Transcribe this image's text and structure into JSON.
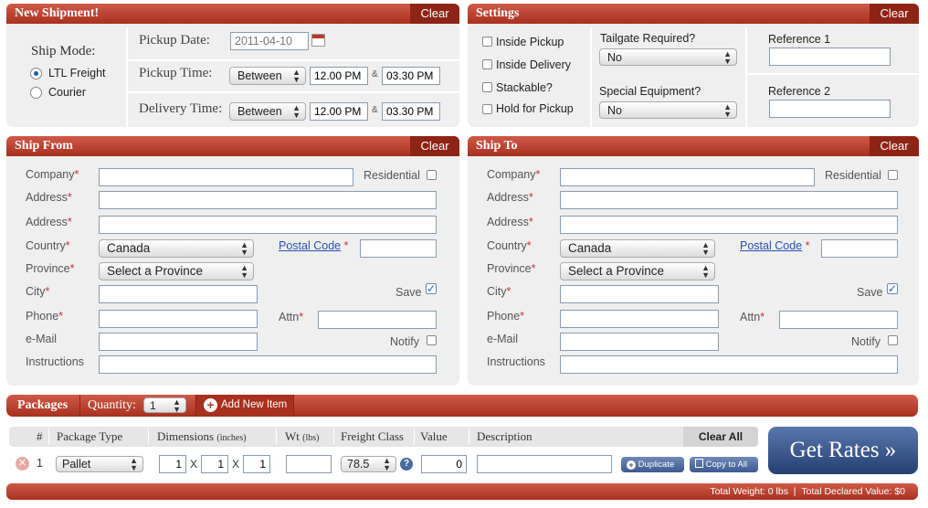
{
  "new_shipment": {
    "title": "New Shipment!",
    "clear": "Clear",
    "ship_mode_label": "Ship Mode:",
    "mode_ltl": "LTL Freight",
    "mode_courier": "Courier",
    "pickup_date_label": "Pickup Date:",
    "pickup_date_value": "2011-04-10",
    "pickup_time_label": "Pickup Time:",
    "delivery_time_label": "Delivery Time:",
    "between": "Between",
    "pickup_from": "12.00 PM",
    "pickup_to": "03.30 PM",
    "delivery_from": "12.00 PM",
    "delivery_to": "03.30 PM",
    "amp": "&"
  },
  "settings": {
    "title": "Settings",
    "clear": "Clear",
    "inside_pickup": "Inside Pickup",
    "inside_delivery": "Inside Delivery",
    "stackable": "Stackable?",
    "hold_for_pickup": "Hold for Pickup",
    "tailgate_label": "Tailgate Required?",
    "tailgate_value": "No",
    "special_label": "Special Equipment?",
    "special_value": "No",
    "ref1": "Reference 1",
    "ref2": "Reference 2"
  },
  "ship_from": {
    "title": "Ship From",
    "clear": "Clear",
    "company": "Company",
    "residential": "Residential",
    "address1": "Address",
    "address2": "Address",
    "country": "Country",
    "country_value": "Canada",
    "postal_code": "Postal Code",
    "province": "Province",
    "province_value": "Select a Province",
    "city": "City",
    "save": "Save",
    "phone": "Phone",
    "attn": "Attn",
    "email": "e-Mail",
    "notify": "Notify",
    "instructions": "Instructions",
    "req": "*"
  },
  "ship_to": {
    "title": "Ship To",
    "clear": "Clear",
    "company": "Company",
    "residential": "Residential",
    "address1": "Address",
    "address2": "Address",
    "country": "Country",
    "country_value": "Canada",
    "postal_code": "Postal Code",
    "province": "Province",
    "province_value": "Select a Province",
    "city": "City",
    "save": "Save",
    "phone": "Phone",
    "attn": "Attn",
    "email": "e-Mail",
    "notify": "Notify",
    "instructions": "Instructions",
    "req": "*"
  },
  "packages": {
    "title": "Packages",
    "quantity_label": "Quantity:",
    "quantity_value": "1",
    "add_item": "Add New Item",
    "col_num": "#",
    "col_type": "Package Type",
    "col_dims": "Dimensions",
    "col_dims_unit": "(inches)",
    "col_wt": "Wt",
    "col_wt_unit": "(lbs)",
    "col_class": "Freight Class",
    "col_value": "Value",
    "col_desc": "Description",
    "clear_all": "Clear All",
    "row": {
      "num": "1",
      "type": "Pallet",
      "d1": "1",
      "d2": "1",
      "d3": "1",
      "x": "X",
      "weight": "",
      "freight_class": "78.5",
      "value": "0",
      "description": ""
    },
    "duplicate": "Duplicate",
    "copy_to_all": "Copy to All"
  },
  "get_rates": "Get Rates »",
  "footer": {
    "total_weight": "Total Weight: 0 lbs",
    "sep": "|",
    "total_value": "Total Declared Value: $0"
  },
  "colors": {
    "header_red": "#b83a28",
    "accent_blue": "#3d5a8f"
  }
}
